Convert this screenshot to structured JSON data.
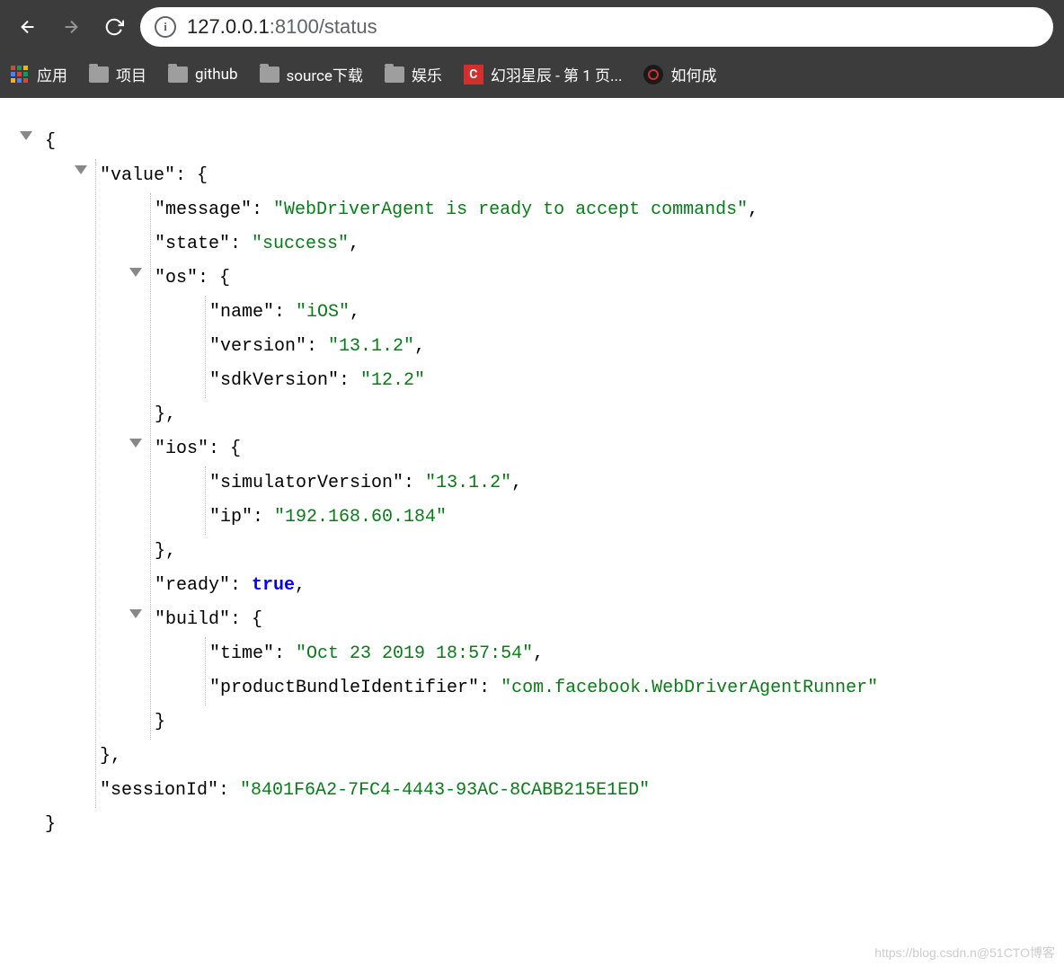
{
  "toolbar": {
    "url_host": "127.0.0.1",
    "url_port": ":8100",
    "url_path": "/status"
  },
  "bookmarks": {
    "apps_label": "应用",
    "items": [
      {
        "label": "项目"
      },
      {
        "label": "github"
      },
      {
        "label": "source下载"
      },
      {
        "label": "娱乐"
      },
      {
        "label": "幻羽星辰 - 第 1 页..."
      },
      {
        "label": "如何成"
      }
    ]
  },
  "json": {
    "value_key": "\"value\"",
    "message_key": "\"message\"",
    "message_val": "\"WebDriverAgent is ready to accept commands\"",
    "state_key": "\"state\"",
    "state_val": "\"success\"",
    "os_key": "\"os\"",
    "os_name_key": "\"name\"",
    "os_name_val": "\"iOS\"",
    "os_version_key": "\"version\"",
    "os_version_val": "\"13.1.2\"",
    "os_sdk_key": "\"sdkVersion\"",
    "os_sdk_val": "\"12.2\"",
    "ios_key": "\"ios\"",
    "ios_sim_key": "\"simulatorVersion\"",
    "ios_sim_val": "\"13.1.2\"",
    "ios_ip_key": "\"ip\"",
    "ios_ip_val": "\"192.168.60.184\"",
    "ready_key": "\"ready\"",
    "ready_val": "true",
    "build_key": "\"build\"",
    "build_time_key": "\"time\"",
    "build_time_val": "\"Oct 23 2019 18:57:54\"",
    "build_pbi_key": "\"productBundleIdentifier\"",
    "build_pbi_val": "\"com.facebook.WebDriverAgentRunner\"",
    "session_key": "\"sessionId\"",
    "session_val": "\"8401F6A2-7FC4-4443-93AC-8CABB215E1ED\""
  },
  "watermark": "https://blog.csdn.n@51CTO博客"
}
